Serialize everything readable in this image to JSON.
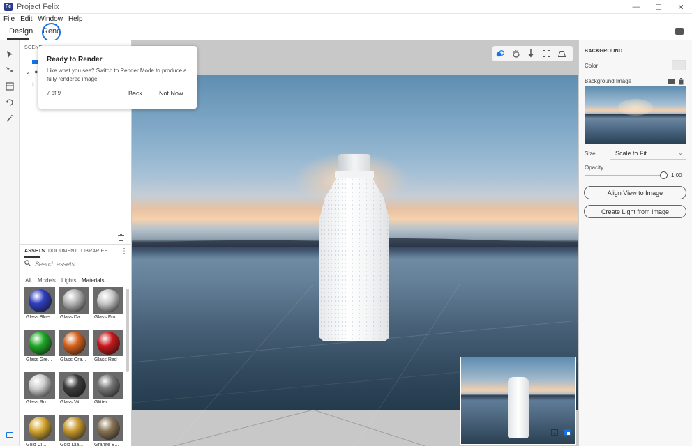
{
  "window": {
    "title": "Project Felix",
    "logo_text": "Fe",
    "controls": {
      "minimize": "—",
      "maximize": "☐",
      "close": "✕"
    }
  },
  "menu": [
    "File",
    "Edit",
    "Window",
    "Help"
  ],
  "modes": {
    "design": "Design",
    "render": "Render"
  },
  "left_toolbar": {
    "icons": [
      "select-arrow-icon",
      "move-icon",
      "frame-icon",
      "rotate-icon",
      "magic-wand-icon"
    ]
  },
  "scene": {
    "label": "SCENE"
  },
  "assets": {
    "tabs": [
      "ASSETS",
      "DOCUMENT",
      "LIBRARIES"
    ],
    "search_placeholder": "Search assets...",
    "filters": [
      "All",
      "Models",
      "Lights",
      "Materials"
    ],
    "active_filter": "Materials",
    "materials": [
      {
        "label": "Glass Blue",
        "color": "#2f3fbf"
      },
      {
        "label": "Glass Da...",
        "color": "#b5b5b5"
      },
      {
        "label": "Glass Fro...",
        "color": "#c9c9c9"
      },
      {
        "label": "Glass Gre...",
        "color": "#1fa827"
      },
      {
        "label": "Glass Ora...",
        "color": "#d5611b"
      },
      {
        "label": "Glass Red",
        "color": "#c8181d"
      },
      {
        "label": "Glass Ro...",
        "color": "#cfcfcf"
      },
      {
        "label": "Glass Vitr...",
        "color": "#3b3b3b"
      },
      {
        "label": "Glitter",
        "color": "#777777"
      },
      {
        "label": "Gold Cl...",
        "color": "#d6a832"
      },
      {
        "label": "Gold Dia...",
        "color": "#c99a2e"
      },
      {
        "label": "Granite B...",
        "color": "#8a7456"
      }
    ]
  },
  "popup": {
    "title": "Ready to Render",
    "body": "Like what you see? Switch to Render Mode to produce a fully rendered image.",
    "step": "7 of 9",
    "back": "Back",
    "not_now": "Not Now"
  },
  "right_panel": {
    "section": "BACKGROUND",
    "color_label": "Color",
    "color_value": "#e6e6e6",
    "bg_image_label": "Background Image",
    "size_label": "Size",
    "size_value": "Scale to Fit",
    "opacity_label": "Opacity",
    "opacity_value": "1.00",
    "align_button": "Align View to Image",
    "light_button": "Create Light from Image"
  }
}
